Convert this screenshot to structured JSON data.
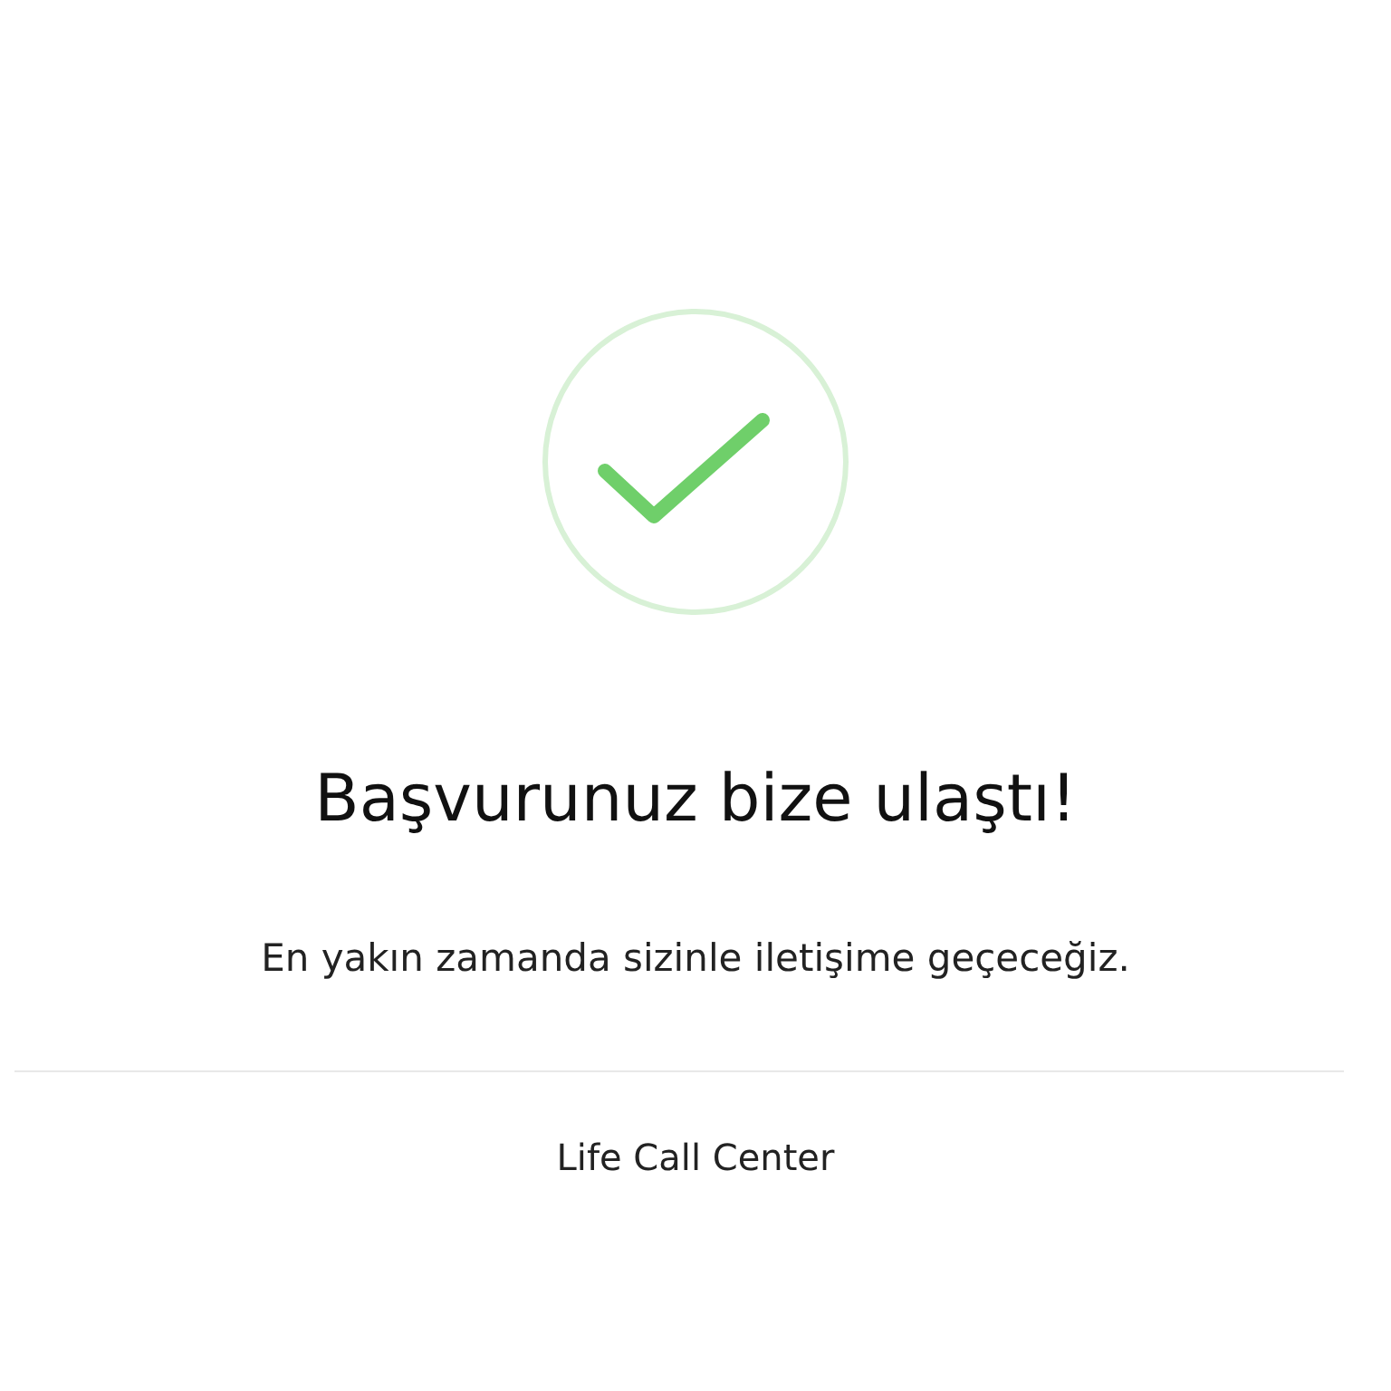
{
  "title": "Başvurunuz bize ulaştı!",
  "message": "En yakın zamanda sizinle iletişime geçeceğiz.",
  "footer": "Life Call Center"
}
